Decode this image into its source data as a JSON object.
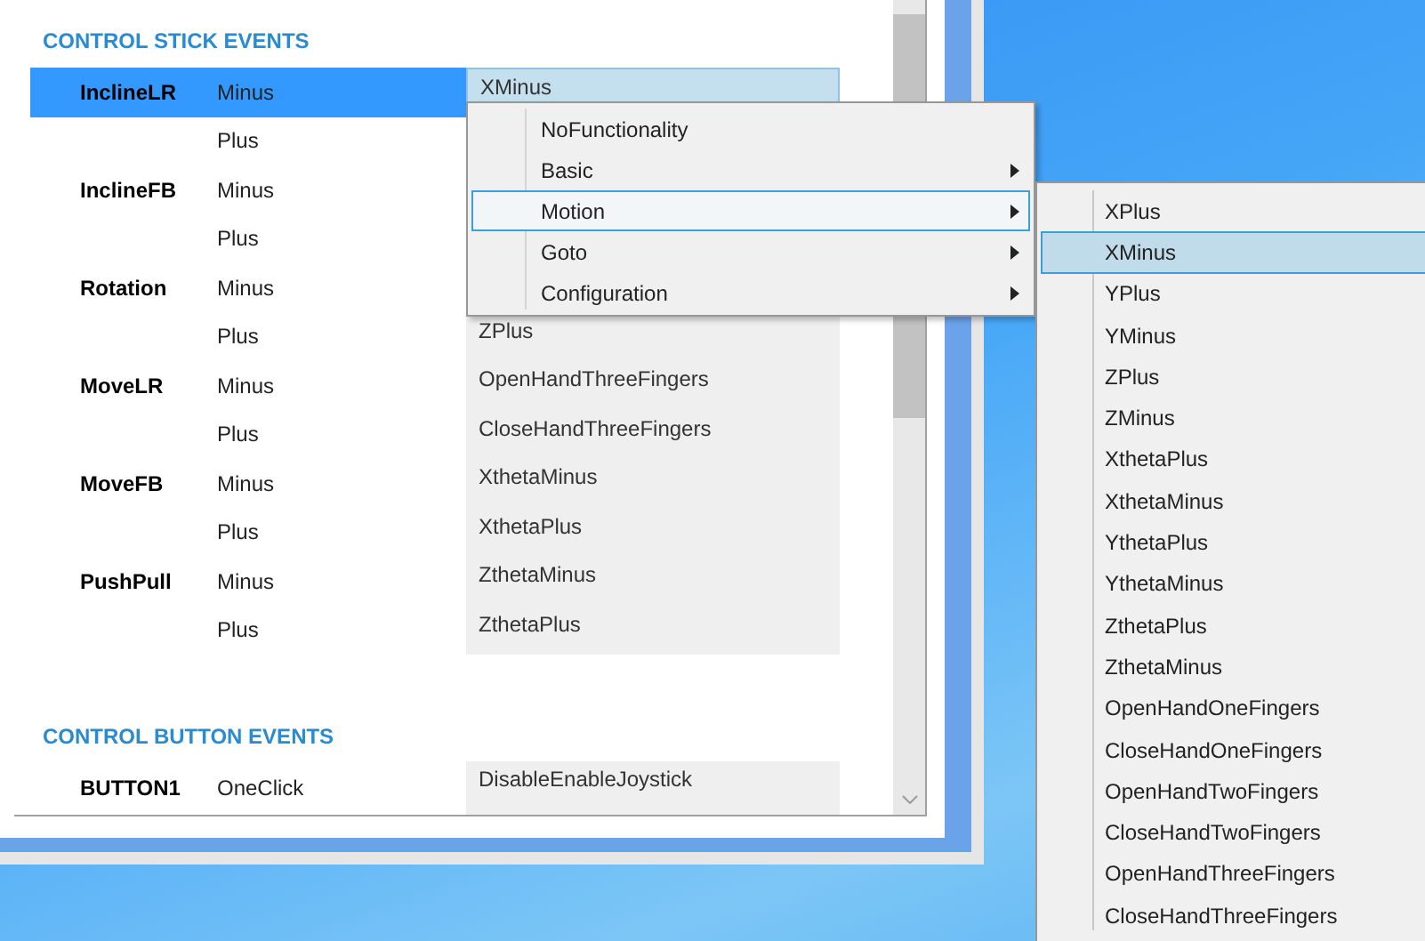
{
  "stick_events": {
    "heading": "CONTROL STICK EVENTS",
    "rows": [
      {
        "control": "InclineLR",
        "event": "Minus",
        "action": "XMinus",
        "selected": true
      },
      {
        "event": "Plus",
        "selected": false
      },
      {
        "control": "InclineFB",
        "event": "Minus",
        "selected": false
      },
      {
        "event": "Plus",
        "selected": false
      },
      {
        "control": "Rotation",
        "event": "Minus",
        "selected": false
      },
      {
        "event": "Plus",
        "action": "ZPlus",
        "selected": false
      },
      {
        "control": "MoveLR",
        "event": "Minus",
        "action": "OpenHandThreeFingers",
        "selected": false
      },
      {
        "event": "Plus",
        "action": "CloseHandThreeFingers",
        "selected": false
      },
      {
        "control": "MoveFB",
        "event": "Minus",
        "action": "XthetaMinus",
        "selected": false
      },
      {
        "event": "Plus",
        "action": "XthetaPlus",
        "selected": false
      },
      {
        "control": "PushPull",
        "event": "Minus",
        "action": "ZthetaMinus",
        "selected": false
      },
      {
        "event": "Plus",
        "action": "ZthetaPlus",
        "selected": false
      }
    ]
  },
  "button_events": {
    "heading": "CONTROL BUTTON EVENTS",
    "rows": [
      {
        "control": "BUTTON1",
        "event": "OneClick",
        "action": "DisableEnableJoystick",
        "selected": false
      }
    ]
  },
  "context_menu": {
    "items": [
      {
        "label": "NoFunctionality",
        "has_submenu": false,
        "selected": false
      },
      {
        "label": "Basic",
        "has_submenu": true,
        "selected": false
      },
      {
        "label": "Motion",
        "has_submenu": true,
        "selected": true
      },
      {
        "label": "Goto",
        "has_submenu": true,
        "selected": false
      },
      {
        "label": "Configuration",
        "has_submenu": true,
        "selected": false
      }
    ]
  },
  "submenu": {
    "items": [
      {
        "label": "XPlus",
        "selected": false
      },
      {
        "label": "XMinus",
        "selected": true
      },
      {
        "label": "YPlus",
        "selected": false
      },
      {
        "label": "YMinus",
        "selected": false
      },
      {
        "label": "ZPlus",
        "selected": false
      },
      {
        "label": "ZMinus",
        "selected": false
      },
      {
        "label": "XthetaPlus",
        "selected": false
      },
      {
        "label": "XthetaMinus",
        "selected": false
      },
      {
        "label": "YthetaPlus",
        "selected": false
      },
      {
        "label": "YthetaMinus",
        "selected": false
      },
      {
        "label": "ZthetaPlus",
        "selected": false
      },
      {
        "label": "ZthetaMinus",
        "selected": false
      },
      {
        "label": "OpenHandOneFingers",
        "selected": false
      },
      {
        "label": "CloseHandOneFingers",
        "selected": false
      },
      {
        "label": "OpenHandTwoFingers",
        "selected": false
      },
      {
        "label": "CloseHandTwoFingers",
        "selected": false
      },
      {
        "label": "OpenHandThreeFingers",
        "selected": false
      },
      {
        "label": "CloseHandThreeFingers",
        "selected": false
      }
    ]
  }
}
